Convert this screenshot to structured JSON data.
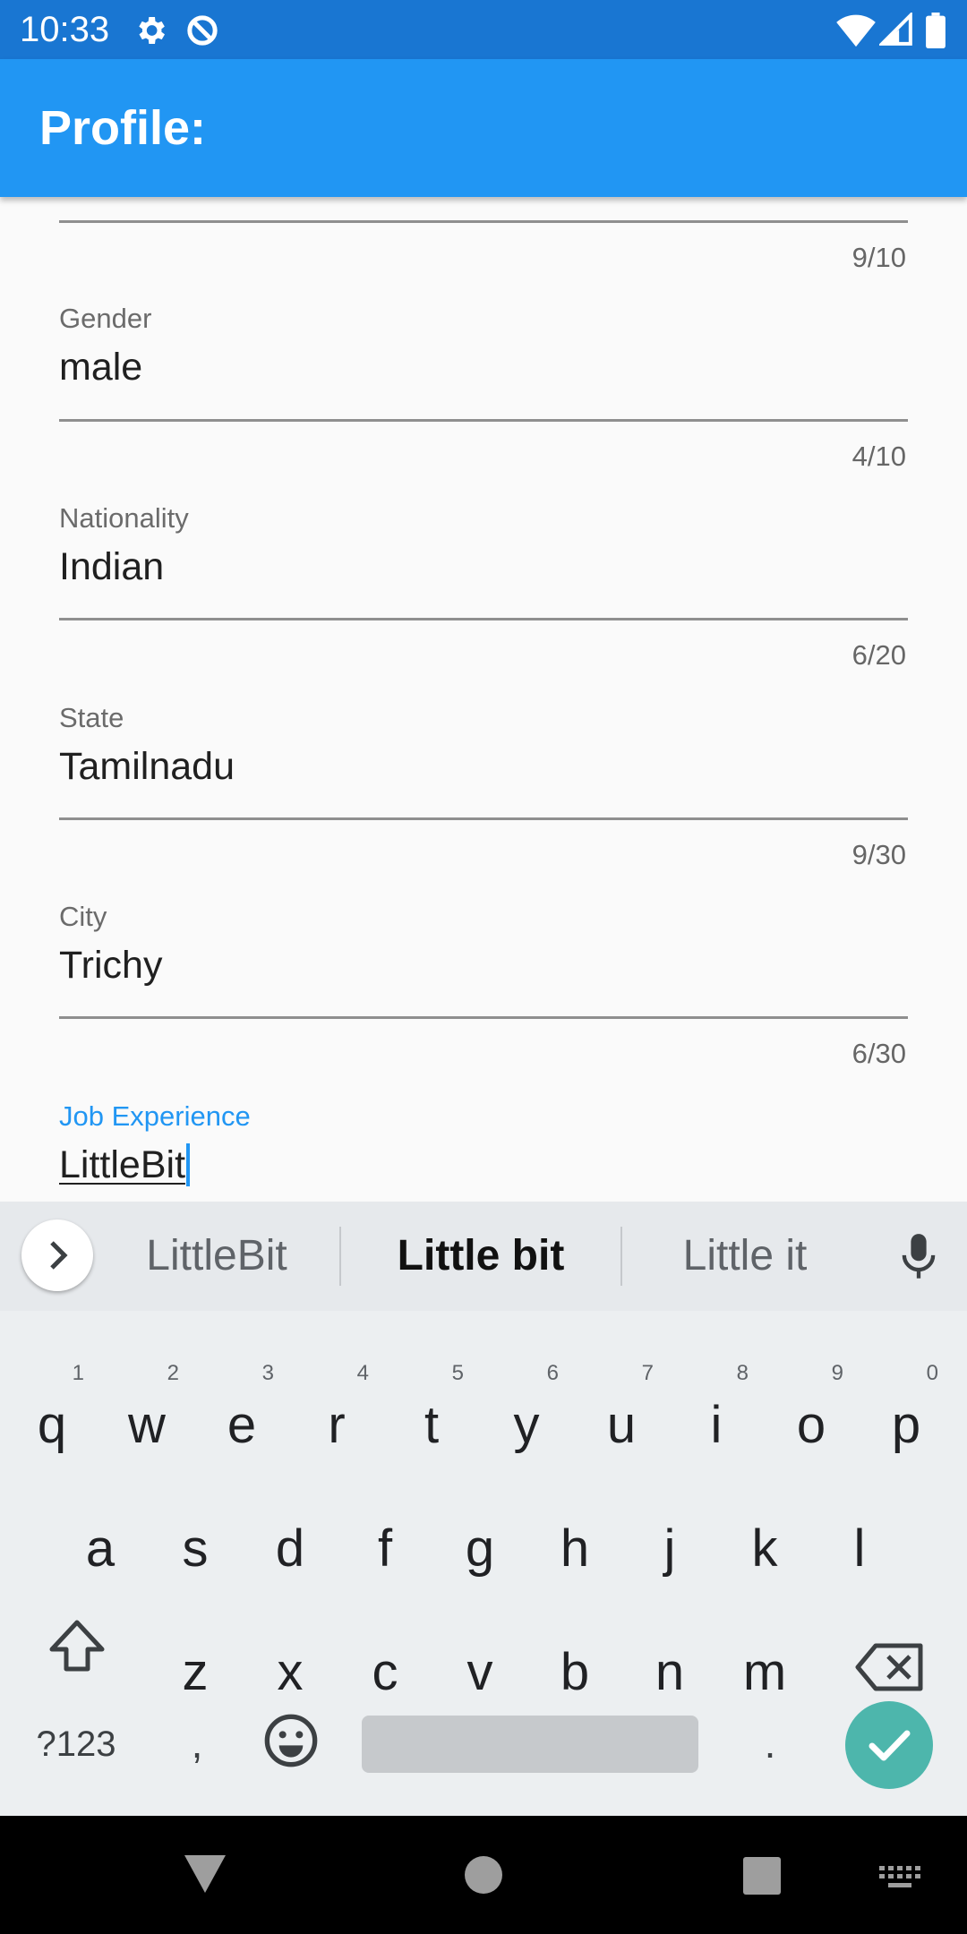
{
  "status_bar": {
    "time": "10:33",
    "icons": [
      "settings-icon",
      "data-saver-icon",
      "wifi-icon",
      "signal-icon",
      "battery-icon"
    ]
  },
  "app_bar": {
    "title": "Profile:"
  },
  "form": {
    "top_counter": "9/10",
    "fields": [
      {
        "label": "Gender",
        "value": "male",
        "counter": "4/10"
      },
      {
        "label": "Nationality",
        "value": "Indian",
        "counter": "6/20"
      },
      {
        "label": "State",
        "value": "Tamilnadu",
        "counter": "9/30"
      },
      {
        "label": "City",
        "value": "Trichy",
        "counter": "6/30"
      },
      {
        "label": "Job Experience",
        "value": "LittleBit",
        "focused": true
      }
    ]
  },
  "keyboard": {
    "suggestions": [
      "LittleBit",
      "Little bit",
      "Little it"
    ],
    "row1": [
      {
        "key": "q",
        "hint": "1"
      },
      {
        "key": "w",
        "hint": "2"
      },
      {
        "key": "e",
        "hint": "3"
      },
      {
        "key": "r",
        "hint": "4"
      },
      {
        "key": "t",
        "hint": "5"
      },
      {
        "key": "y",
        "hint": "6"
      },
      {
        "key": "u",
        "hint": "7"
      },
      {
        "key": "i",
        "hint": "8"
      },
      {
        "key": "o",
        "hint": "9"
      },
      {
        "key": "p",
        "hint": "0"
      }
    ],
    "row2": [
      "a",
      "s",
      "d",
      "f",
      "g",
      "h",
      "j",
      "k",
      "l"
    ],
    "row3": [
      "z",
      "x",
      "c",
      "v",
      "b",
      "n",
      "m"
    ],
    "symbols_key": "?123",
    "comma_key": ",",
    "period_key": "."
  },
  "colors": {
    "status_bar": "#1976d2",
    "app_bar": "#2196f3",
    "accent": "#2196f3",
    "enter_key": "#4db6ac"
  }
}
